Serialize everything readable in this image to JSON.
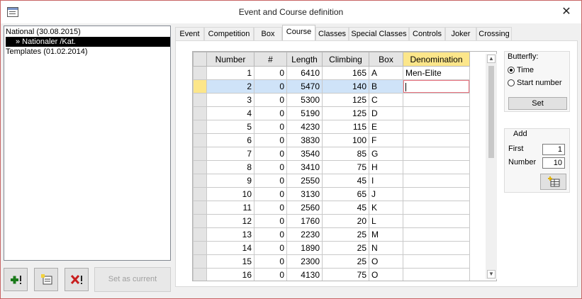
{
  "window": {
    "title": "Event and Course definition"
  },
  "tree": {
    "items": [
      {
        "label": "National (30.08.2015)",
        "selected": false
      },
      {
        "label": "» Nationaler /Kat.",
        "selected": true
      },
      {
        "label": "Templates (01.02.2014)",
        "selected": false
      }
    ]
  },
  "bottom_buttons": {
    "set_as_current_label": "Set as current"
  },
  "tabs": [
    {
      "label": "Event"
    },
    {
      "label": "Competition"
    },
    {
      "label": "Box"
    },
    {
      "label": "Course"
    },
    {
      "label": "Classes"
    },
    {
      "label": "Special Classes"
    },
    {
      "label": "Controls"
    },
    {
      "label": "Joker"
    },
    {
      "label": "Crossing"
    }
  ],
  "active_tab": "Course",
  "grid": {
    "columns": [
      "Number",
      "#",
      "Length",
      "Climbing",
      "Box",
      "Denomination"
    ],
    "rows": [
      [
        "1",
        "0",
        "6410",
        "165",
        "A",
        "Men-Elite"
      ],
      [
        "2",
        "0",
        "5470",
        "140",
        "B",
        ""
      ],
      [
        "3",
        "0",
        "5300",
        "125",
        "C",
        ""
      ],
      [
        "4",
        "0",
        "5190",
        "125",
        "D",
        ""
      ],
      [
        "5",
        "0",
        "4230",
        "115",
        "E",
        ""
      ],
      [
        "6",
        "0",
        "3830",
        "100",
        "F",
        ""
      ],
      [
        "7",
        "0",
        "3540",
        "85",
        "G",
        ""
      ],
      [
        "8",
        "0",
        "3410",
        "75",
        "H",
        ""
      ],
      [
        "9",
        "0",
        "2550",
        "45",
        "I",
        ""
      ],
      [
        "10",
        "0",
        "3130",
        "65",
        "J",
        ""
      ],
      [
        "11",
        "0",
        "2560",
        "45",
        "K",
        ""
      ],
      [
        "12",
        "0",
        "1760",
        "20",
        "L",
        ""
      ],
      [
        "13",
        "0",
        "2230",
        "25",
        "M",
        ""
      ],
      [
        "14",
        "0",
        "1890",
        "25",
        "N",
        ""
      ],
      [
        "15",
        "0",
        "2300",
        "25",
        "O",
        ""
      ],
      [
        "16",
        "0",
        "4130",
        "75",
        "O",
        ""
      ]
    ],
    "current_row": 2
  },
  "butterfly": {
    "title": "Butterfly:",
    "options": [
      {
        "label": "Time",
        "checked": true
      },
      {
        "label": "Start number",
        "checked": false
      }
    ],
    "set_label": "Set"
  },
  "add": {
    "title": "Add",
    "first_label": "First",
    "first_value": "1",
    "number_label": "Number",
    "number_value": "10"
  },
  "colors": {
    "header_highlight": "#fce68a",
    "selected_row": "#cfe3f8",
    "edit_border": "#e8717e"
  }
}
